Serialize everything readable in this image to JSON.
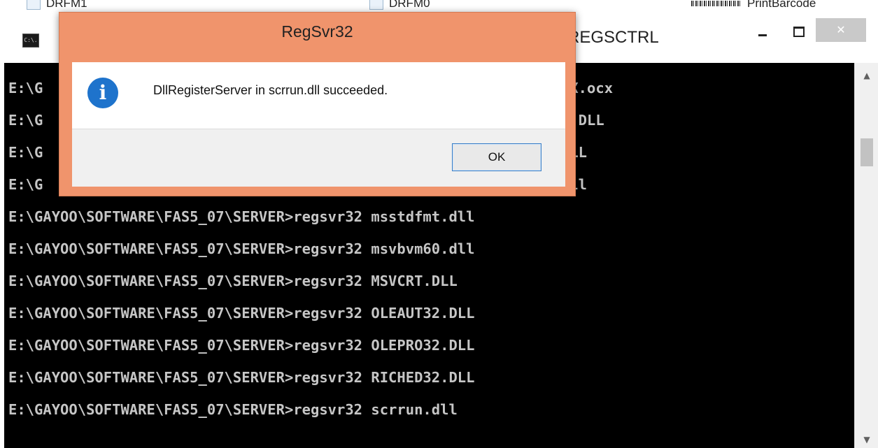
{
  "background_explorer": {
    "items": [
      "DRFM1",
      "DRFM0",
      "PrintBarcode"
    ]
  },
  "console": {
    "icon_text": "C:\\.",
    "title_visible": "REGSCTRL",
    "close_glyph": "✕",
    "lines": [
      {
        "left": "E:\\G",
        "right": "CX.ocx"
      },
      {
        "left": "E:\\G",
        "right": "T.DLL"
      },
      {
        "left": "E:\\G",
        "right": "DLL"
      },
      {
        "left": "E:\\G",
        "right": "dll"
      },
      {
        "left": "E:\\GAYOO\\SOFTWARE\\FAS5_07\\SERVER>regsvr32 msstdfmt.dll",
        "right": ""
      },
      {
        "left": "E:\\GAYOO\\SOFTWARE\\FAS5_07\\SERVER>regsvr32 msvbvm60.dll",
        "right": ""
      },
      {
        "left": "E:\\GAYOO\\SOFTWARE\\FAS5_07\\SERVER>regsvr32 MSVCRT.DLL",
        "right": ""
      },
      {
        "left": "E:\\GAYOO\\SOFTWARE\\FAS5_07\\SERVER>regsvr32 OLEAUT32.DLL",
        "right": ""
      },
      {
        "left": "E:\\GAYOO\\SOFTWARE\\FAS5_07\\SERVER>regsvr32 OLEPRO32.DLL",
        "right": ""
      },
      {
        "left": "E:\\GAYOO\\SOFTWARE\\FAS5_07\\SERVER>regsvr32 RICHED32.DLL",
        "right": ""
      },
      {
        "left": "E:\\GAYOO\\SOFTWARE\\FAS5_07\\SERVER>regsvr32 scrrun.dll",
        "right": ""
      }
    ],
    "scroll_up": "▲",
    "scroll_down": "▼"
  },
  "dialog": {
    "title": "RegSvr32",
    "icon_glyph": "i",
    "message": "DllRegisterServer in scrrun.dll succeeded.",
    "ok_label": "OK"
  },
  "colors": {
    "dialog_frame": "#f0946c",
    "console_bg": "#000000",
    "console_text": "#c6c6c6",
    "info_icon": "#1e73cc",
    "ok_border": "#3c7fc6"
  }
}
